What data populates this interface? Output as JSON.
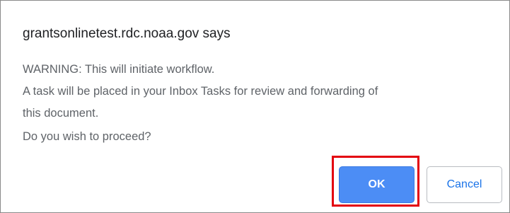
{
  "dialog": {
    "title": "grantsonlinetest.rdc.noaa.gov says",
    "message_lines": [
      "WARNING: This will initiate workflow.",
      "A task will be placed in your Inbox Tasks for review and forwarding of",
      "this document.",
      "Do you wish to proceed?"
    ],
    "ok_label": "OK",
    "cancel_label": "Cancel"
  },
  "colors": {
    "ok_button": "#4c8df5",
    "highlight_border": "#e3000f"
  }
}
